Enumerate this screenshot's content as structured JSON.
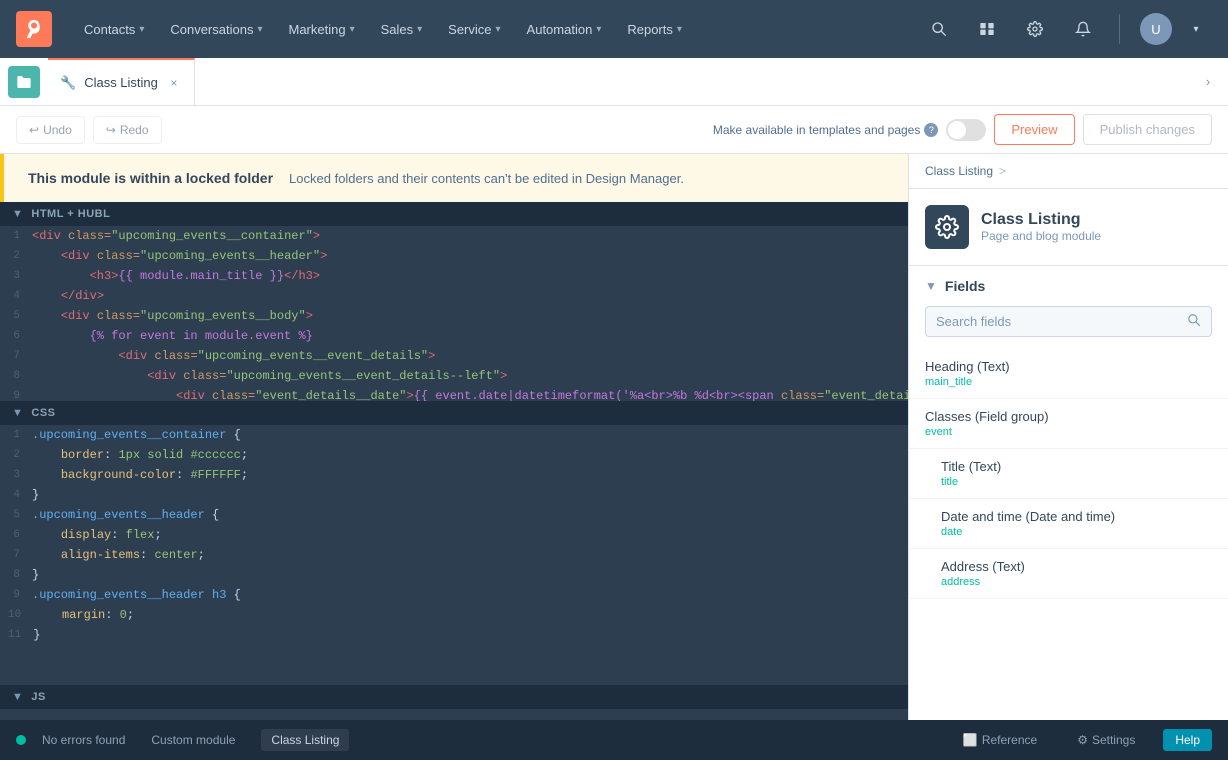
{
  "topnav": {
    "logo_label": "HubSpot",
    "items": [
      {
        "label": "Contacts",
        "has_chevron": true
      },
      {
        "label": "Conversations",
        "has_chevron": true
      },
      {
        "label": "Marketing",
        "has_chevron": true
      },
      {
        "label": "Sales",
        "has_chevron": true
      },
      {
        "label": "Service",
        "has_chevron": true
      },
      {
        "label": "Automation",
        "has_chevron": true
      },
      {
        "label": "Reports",
        "has_chevron": true
      }
    ]
  },
  "tabbar": {
    "active_tab": "Class Listing",
    "tab_icon": "🔧",
    "close_icon": "×"
  },
  "toolbar": {
    "undo_label": "Undo",
    "redo_label": "Redo",
    "make_available_label": "Make available in templates and pages",
    "preview_label": "Preview",
    "publish_label": "Publish changes"
  },
  "locked_banner": {
    "title": "This module is within a locked folder",
    "description": "Locked folders and their contents can't be edited in Design Manager."
  },
  "html_section": {
    "label": "HTML + HUBL",
    "lines": [
      {
        "num": 1,
        "tokens": [
          {
            "type": "tok-tag",
            "text": "<div"
          },
          {
            "type": "tok-attr",
            "text": " class="
          },
          {
            "type": "tok-str",
            "text": "\"upcoming_events__container\""
          },
          {
            "type": "tok-tag",
            "text": ">"
          }
        ]
      },
      {
        "num": 2,
        "tokens": [
          {
            "type": "plain",
            "text": "    "
          },
          {
            "type": "tok-tag",
            "text": "<div"
          },
          {
            "type": "tok-attr",
            "text": " class="
          },
          {
            "type": "tok-str",
            "text": "\"upcoming_events__header\""
          },
          {
            "type": "tok-tag",
            "text": ">"
          }
        ]
      },
      {
        "num": 3,
        "tokens": [
          {
            "type": "plain",
            "text": "        "
          },
          {
            "type": "tok-tag",
            "text": "<h3>"
          },
          {
            "type": "tok-tmpl",
            "text": "{{ module.main_title }}"
          },
          {
            "type": "tok-tag",
            "text": "</h3>"
          }
        ]
      },
      {
        "num": 4,
        "tokens": [
          {
            "type": "plain",
            "text": "    "
          },
          {
            "type": "tok-tag",
            "text": "</div>"
          }
        ]
      },
      {
        "num": 5,
        "tokens": [
          {
            "type": "plain",
            "text": "    "
          },
          {
            "type": "tok-tag",
            "text": "<div"
          },
          {
            "type": "tok-attr",
            "text": " class="
          },
          {
            "type": "tok-str",
            "text": "\"upcoming_events__body\""
          },
          {
            "type": "tok-tag",
            "text": ">"
          }
        ]
      },
      {
        "num": 6,
        "tokens": [
          {
            "type": "plain",
            "text": "        "
          },
          {
            "type": "tok-tmpl",
            "text": "{% for event in module.event %}"
          }
        ]
      },
      {
        "num": 7,
        "tokens": [
          {
            "type": "plain",
            "text": "            "
          },
          {
            "type": "tok-tag",
            "text": "<div"
          },
          {
            "type": "tok-attr",
            "text": " class="
          },
          {
            "type": "tok-str",
            "text": "\"upcoming_events__event_details\""
          },
          {
            "type": "tok-tag",
            "text": ">"
          }
        ]
      },
      {
        "num": 8,
        "tokens": [
          {
            "type": "plain",
            "text": "                "
          },
          {
            "type": "tok-tag",
            "text": "<div"
          },
          {
            "type": "tok-attr",
            "text": " class="
          },
          {
            "type": "tok-str",
            "text": "\"upcoming_events__event_details--left\""
          },
          {
            "type": "tok-tag",
            "text": ">"
          }
        ]
      },
      {
        "num": 9,
        "tokens": [
          {
            "type": "plain",
            "text": "                    "
          },
          {
            "type": "tok-tag",
            "text": "<div"
          },
          {
            "type": "tok-attr",
            "text": " class="
          },
          {
            "type": "tok-str",
            "text": "\"event_details__date\""
          },
          {
            "type": "tok-tag",
            "text": ">"
          },
          {
            "type": "tok-tmpl",
            "text": "{{ event.date|datetimeformat('%a<br>%b %d<br><span"
          },
          {
            "type": "plain",
            "text": " "
          },
          {
            "type": "tok-attr",
            "text": "class="
          },
          {
            "type": "tok-str",
            "text": "\"event_details__date--small\""
          }
        ]
      }
    ]
  },
  "css_section": {
    "label": "CSS",
    "lines": [
      {
        "num": 1,
        "tokens": [
          {
            "type": "tok-prop",
            "text": ".upcoming_events__container"
          },
          {
            "type": "plain",
            "text": " {"
          }
        ]
      },
      {
        "num": 2,
        "tokens": [
          {
            "type": "plain",
            "text": "    "
          },
          {
            "type": "tok-val",
            "text": "border"
          },
          {
            "type": "plain",
            "text": ": "
          },
          {
            "type": "tok-str",
            "text": "1px solid #cccccc"
          },
          {
            "type": "plain",
            "text": ";"
          }
        ]
      },
      {
        "num": 3,
        "tokens": [
          {
            "type": "plain",
            "text": "    "
          },
          {
            "type": "tok-val",
            "text": "background-color"
          },
          {
            "type": "plain",
            "text": ": "
          },
          {
            "type": "tok-str",
            "text": "#FFFFFF"
          },
          {
            "type": "plain",
            "text": ";"
          }
        ]
      },
      {
        "num": 4,
        "tokens": [
          {
            "type": "plain",
            "text": "}"
          }
        ]
      },
      {
        "num": 5,
        "tokens": [
          {
            "type": "tok-prop",
            "text": ".upcoming_events__header"
          },
          {
            "type": "plain",
            "text": " {"
          }
        ]
      },
      {
        "num": 6,
        "tokens": [
          {
            "type": "plain",
            "text": "    "
          },
          {
            "type": "tok-val",
            "text": "display"
          },
          {
            "type": "plain",
            "text": ": "
          },
          {
            "type": "tok-str",
            "text": "flex"
          },
          {
            "type": "plain",
            "text": ";"
          }
        ]
      },
      {
        "num": 7,
        "tokens": [
          {
            "type": "plain",
            "text": "    "
          },
          {
            "type": "tok-val",
            "text": "align-items"
          },
          {
            "type": "plain",
            "text": ": "
          },
          {
            "type": "tok-str",
            "text": "center"
          },
          {
            "type": "plain",
            "text": ";"
          }
        ]
      },
      {
        "num": 8,
        "tokens": [
          {
            "type": "plain",
            "text": "}"
          }
        ]
      },
      {
        "num": 9,
        "tokens": [
          {
            "type": "tok-prop",
            "text": ".upcoming_events__header h3"
          },
          {
            "type": "plain",
            "text": " {"
          }
        ]
      },
      {
        "num": 10,
        "tokens": [
          {
            "type": "plain",
            "text": "    "
          },
          {
            "type": "tok-val",
            "text": "margin"
          },
          {
            "type": "plain",
            "text": ": "
          },
          {
            "type": "tok-str",
            "text": "0"
          },
          {
            "type": "plain",
            "text": ";"
          }
        ]
      },
      {
        "num": 11,
        "tokens": [
          {
            "type": "plain",
            "text": "}"
          }
        ]
      }
    ]
  },
  "js_section": {
    "label": "JS"
  },
  "right_panel": {
    "breadcrumb_root": "Class Listing",
    "breadcrumb_chevron": ">",
    "module_title": "Class Listing",
    "module_subtitle": "Page and blog module",
    "fields_header": "Fields",
    "search_placeholder": "Search fields",
    "fields": [
      {
        "label": "Heading (Text)",
        "key": "main_title"
      },
      {
        "label": "Classes (Field group)",
        "key": "event"
      },
      {
        "label": "Title (Text)",
        "key": "title"
      },
      {
        "label": "Date and time (Date and time)",
        "key": "date"
      },
      {
        "label": "Address (Text)",
        "key": "address"
      }
    ]
  },
  "bottom_bar": {
    "status": "No errors found",
    "tabs": [
      "Custom module",
      "Class Listing"
    ],
    "active_tab": "Class Listing",
    "reference_label": "Reference",
    "settings_label": "Settings",
    "help_label": "Help"
  },
  "colors": {
    "accent": "#ff7a59",
    "teal": "#00bda5",
    "nav_bg": "#33475b",
    "code_bg": "#2c3e50",
    "code_header_bg": "#1e2d3d"
  }
}
